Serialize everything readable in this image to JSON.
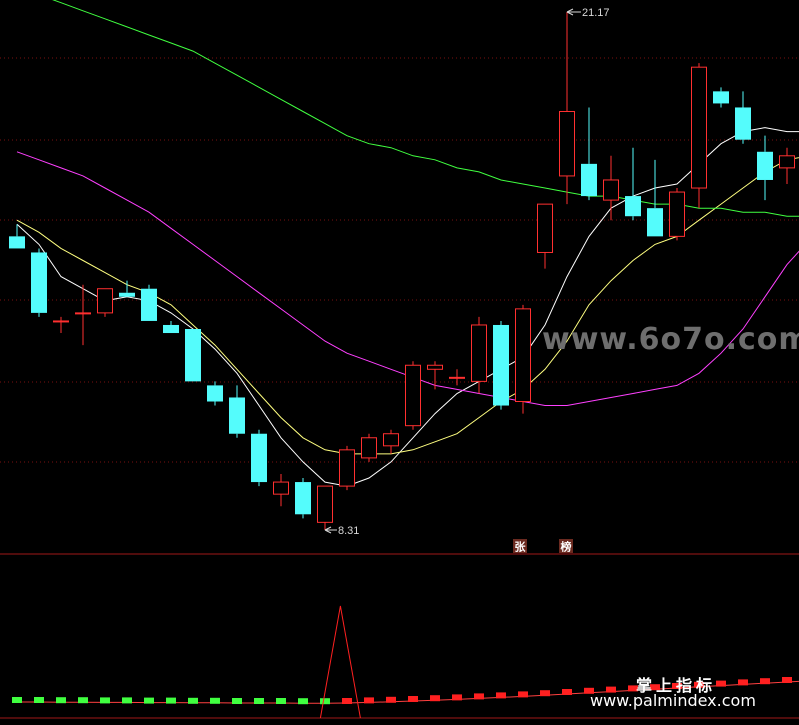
{
  "chart_data": {
    "type": "candlestick",
    "price_high_label": "21.17",
    "price_low_label": "8.31",
    "ylim": [
      8.0,
      22.0
    ],
    "candles": [
      {
        "o": 15.6,
        "h": 15.9,
        "l": 15.3,
        "c": 15.3
      },
      {
        "o": 15.2,
        "h": 15.3,
        "l": 13.6,
        "c": 13.7
      },
      {
        "o": 13.5,
        "h": 13.6,
        "l": 13.2,
        "c": 13.5
      },
      {
        "o": 13.7,
        "h": 14.4,
        "l": 12.9,
        "c": 13.7
      },
      {
        "o": 13.7,
        "h": 14.3,
        "l": 13.6,
        "c": 14.3
      },
      {
        "o": 14.2,
        "h": 14.5,
        "l": 14.1,
        "c": 14.1
      },
      {
        "o": 14.3,
        "h": 14.4,
        "l": 13.5,
        "c": 13.5
      },
      {
        "o": 13.4,
        "h": 13.5,
        "l": 13.2,
        "c": 13.2
      },
      {
        "o": 13.3,
        "h": 13.3,
        "l": 12.0,
        "c": 12.0
      },
      {
        "o": 11.9,
        "h": 12.0,
        "l": 11.4,
        "c": 11.5
      },
      {
        "o": 11.6,
        "h": 11.9,
        "l": 10.6,
        "c": 10.7
      },
      {
        "o": 10.7,
        "h": 10.8,
        "l": 9.4,
        "c": 9.5
      },
      {
        "o": 9.2,
        "h": 9.7,
        "l": 8.9,
        "c": 9.5
      },
      {
        "o": 9.5,
        "h": 9.6,
        "l": 8.6,
        "c": 8.7
      },
      {
        "o": 8.5,
        "h": 9.4,
        "l": 8.31,
        "c": 9.4
      },
      {
        "o": 9.4,
        "h": 10.4,
        "l": 9.3,
        "c": 10.3
      },
      {
        "o": 10.1,
        "h": 10.7,
        "l": 10.0,
        "c": 10.6
      },
      {
        "o": 10.4,
        "h": 10.8,
        "l": 10.2,
        "c": 10.7
      },
      {
        "o": 10.9,
        "h": 12.5,
        "l": 10.8,
        "c": 12.4
      },
      {
        "o": 12.3,
        "h": 12.5,
        "l": 11.8,
        "c": 12.4
      },
      {
        "o": 12.1,
        "h": 12.3,
        "l": 11.9,
        "c": 12.1
      },
      {
        "o": 12.0,
        "h": 13.6,
        "l": 11.7,
        "c": 13.4
      },
      {
        "o": 13.4,
        "h": 13.5,
        "l": 11.3,
        "c": 11.4
      },
      {
        "o": 11.5,
        "h": 13.9,
        "l": 11.2,
        "c": 13.8
      },
      {
        "o": 15.2,
        "h": 16.3,
        "l": 14.8,
        "c": 16.4
      },
      {
        "o": 17.1,
        "h": 21.17,
        "l": 16.4,
        "c": 18.7
      },
      {
        "o": 17.4,
        "h": 18.8,
        "l": 16.5,
        "c": 16.6
      },
      {
        "o": 16.5,
        "h": 17.6,
        "l": 16.0,
        "c": 17.0
      },
      {
        "o": 16.6,
        "h": 17.8,
        "l": 16.0,
        "c": 16.1
      },
      {
        "o": 16.3,
        "h": 17.5,
        "l": 15.6,
        "c": 15.6
      },
      {
        "o": 15.6,
        "h": 16.8,
        "l": 15.5,
        "c": 16.7
      },
      {
        "o": 16.8,
        "h": 19.9,
        "l": 16.3,
        "c": 19.8
      },
      {
        "o": 19.2,
        "h": 19.3,
        "l": 18.8,
        "c": 18.9
      },
      {
        "o": 18.8,
        "h": 19.2,
        "l": 17.9,
        "c": 18.0
      },
      {
        "o": 17.7,
        "h": 18.1,
        "l": 16.5,
        "c": 17.0
      },
      {
        "o": 17.3,
        "h": 17.8,
        "l": 16.9,
        "c": 17.6
      },
      {
        "o": 17.4,
        "h": 18.5,
        "l": 17.2,
        "c": 18.4
      }
    ],
    "ma_lines": [
      {
        "color": "#ffffff",
        "values": [
          15.9,
          15.4,
          14.6,
          14.3,
          14.0,
          14.1,
          14.0,
          13.7,
          13.3,
          12.8,
          12.2,
          11.4,
          10.6,
          10.0,
          9.5,
          9.4,
          9.6,
          10.0,
          10.6,
          11.2,
          11.7,
          12.0,
          12.3,
          12.6,
          13.4,
          14.6,
          15.6,
          16.3,
          16.6,
          16.8,
          16.9,
          17.4,
          17.9,
          18.2,
          18.3,
          18.2,
          18.2
        ]
      },
      {
        "color": "#ffff80",
        "values": [
          16.0,
          15.7,
          15.3,
          15.0,
          14.7,
          14.4,
          14.2,
          13.9,
          13.4,
          12.9,
          12.3,
          11.7,
          11.1,
          10.6,
          10.3,
          10.2,
          10.2,
          10.2,
          10.3,
          10.5,
          10.7,
          11.1,
          11.5,
          11.8,
          12.3,
          13.0,
          13.9,
          14.5,
          15.0,
          15.4,
          15.6,
          16.0,
          16.4,
          16.8,
          17.2,
          17.5,
          17.6
        ]
      },
      {
        "color": "#ff40ff",
        "values": [
          17.7,
          17.5,
          17.3,
          17.1,
          16.8,
          16.5,
          16.2,
          15.8,
          15.4,
          15.0,
          14.6,
          14.2,
          13.8,
          13.4,
          13.0,
          12.7,
          12.5,
          12.3,
          12.1,
          11.9,
          11.8,
          11.7,
          11.6,
          11.5,
          11.4,
          11.4,
          11.5,
          11.6,
          11.7,
          11.8,
          11.9,
          12.2,
          12.7,
          13.3,
          14.1,
          14.9,
          15.5
        ]
      },
      {
        "color": "#40ff40",
        "values": [
          21.9,
          21.6,
          21.4,
          21.2,
          21.0,
          20.8,
          20.6,
          20.4,
          20.2,
          19.9,
          19.6,
          19.3,
          19.0,
          18.7,
          18.4,
          18.1,
          17.9,
          17.8,
          17.6,
          17.5,
          17.3,
          17.2,
          17.0,
          16.9,
          16.8,
          16.7,
          16.6,
          16.6,
          16.5,
          16.4,
          16.4,
          16.3,
          16.3,
          16.2,
          16.2,
          16.1,
          16.1
        ]
      }
    ],
    "tags": [
      "张",
      "榜"
    ],
    "indicator": {
      "bars_values": [
        0.1,
        0.1,
        0.09,
        0.09,
        0.08,
        0.08,
        0.07,
        0.07,
        0.06,
        0.06,
        0.05,
        0.05,
        0.05,
        0.04,
        0.04,
        0.05,
        0.08,
        0.11,
        0.15,
        0.19,
        0.23,
        0.28,
        0.33,
        0.38,
        0.44,
        0.5,
        0.56,
        0.62,
        0.68,
        0.74,
        0.8,
        0.86,
        0.92,
        0.98,
        1.04,
        1.1,
        1.16
      ],
      "bars_colors": [
        "#40ff40",
        "#40ff40",
        "#40ff40",
        "#40ff40",
        "#40ff40",
        "#40ff40",
        "#40ff40",
        "#40ff40",
        "#40ff40",
        "#40ff40",
        "#40ff40",
        "#40ff40",
        "#40ff40",
        "#40ff40",
        "#40ff40",
        "#ff2020",
        "#ff2020",
        "#ff2020",
        "#ff2020",
        "#ff2020",
        "#ff2020",
        "#ff2020",
        "#ff2020",
        "#ff2020",
        "#ff2020",
        "#ff2020",
        "#ff2020",
        "#ff2020",
        "#ff2020",
        "#ff2020",
        "#ff2020",
        "#ff2020",
        "#ff2020",
        "#ff2020",
        "#ff2020",
        "#ff2020",
        "#ff2020"
      ],
      "spike_index": 14.7,
      "spike_value": 4.0
    },
    "colors": {
      "up": "#ff3030",
      "down": "#54fcfc",
      "grid": "#7a1010",
      "divider": "#a01818"
    }
  },
  "watermarks": {
    "main": "www.6o7o.com",
    "cn": "掌上指标",
    "url": "www.palmindex.com"
  }
}
